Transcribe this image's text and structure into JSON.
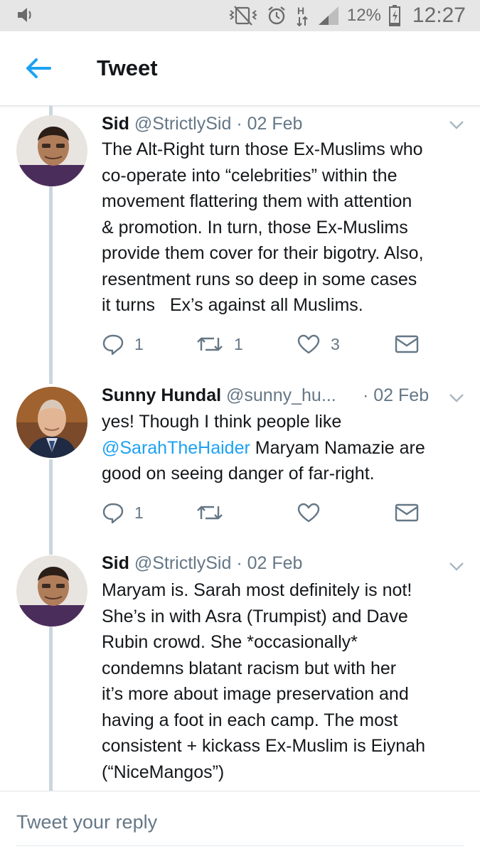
{
  "status_bar": {
    "battery_percent": "12%",
    "time": "12:27",
    "icons": [
      "volume-icon",
      "vibrate-icon",
      "alarm-icon",
      "h-plus-icon",
      "signal-icon",
      "battery-icon"
    ]
  },
  "header": {
    "title": "Tweet",
    "back_icon": "arrow-left-icon"
  },
  "tweets": [
    {
      "name": "Sid",
      "handle": "@StrictlySid",
      "date": "· 02 Feb",
      "lines": [
        "The Alt-Right turn those Ex-Muslims who",
        "co-operate into “celebrities” within the",
        "movement flattering them with attention",
        "& promotion. In turn, those Ex-Muslims",
        "provide them cover for their bigotry. Also,",
        "resentment runs so deep in some cases",
        "it turns   Ex’s against all Muslims."
      ],
      "reply_count": "1",
      "retweet_count": "1",
      "like_count": "3"
    },
    {
      "name": "Sunny Hundal",
      "handle": "@sunny_hu...",
      "date": "· 02 Feb",
      "line1": "yes! Though I think people like",
      "mention": "@SarahTheHaider",
      "line2_rest": " Maryam Namazie are",
      "line3": "good on seeing danger of far-right.",
      "reply_count": "1",
      "retweet_count": "",
      "like_count": ""
    },
    {
      "name": "Sid",
      "handle": "@StrictlySid",
      "date": "· 02 Feb",
      "lines": [
        "Maryam is. Sarah most definitely is not!",
        "She’s in with Asra (Trumpist) and Dave",
        "Rubin crowd. She *occasionally*",
        "condemns blatant racism but with her",
        "it’s more about image preservation and",
        "having a foot in each camp. The most",
        "consistent + kickass Ex-Muslim is Eiynah",
        "(“NiceMangos”)"
      ]
    }
  ],
  "reply_box": {
    "placeholder": "Tweet your reply"
  },
  "colors": {
    "accent": "#1da1f2",
    "text": "#14171a",
    "secondary": "#657786",
    "status_bar_bg": "#e6e6e6",
    "thread_line": "#ccd6dd"
  }
}
